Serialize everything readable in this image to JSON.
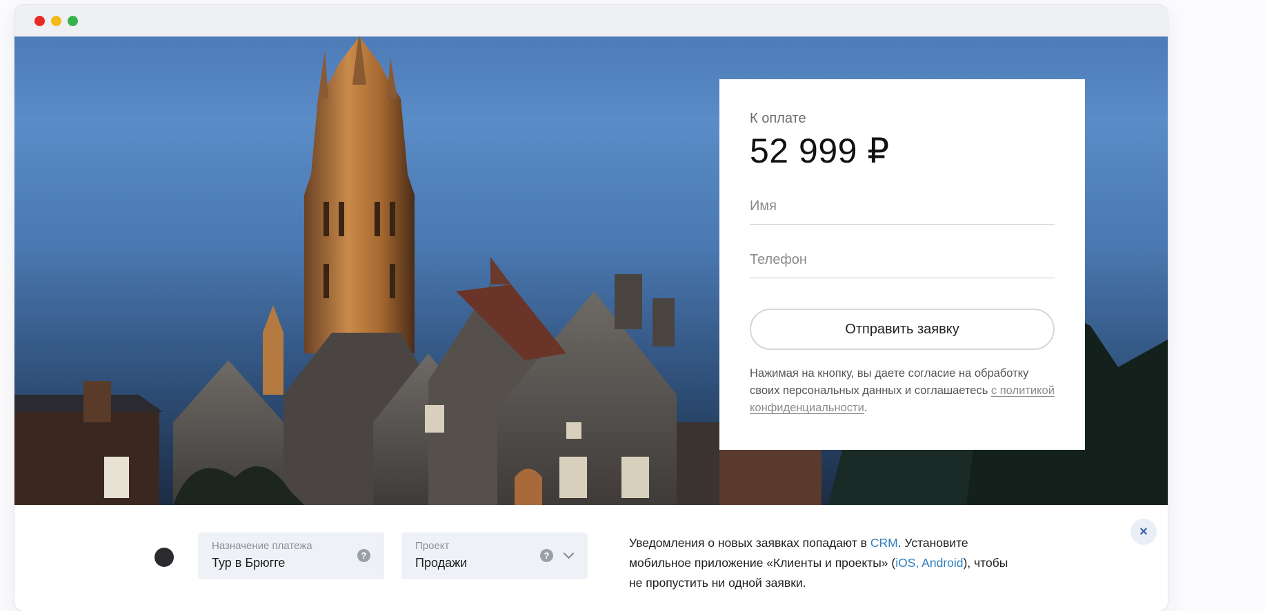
{
  "colors": {
    "accent_link": "#2d7fc1",
    "close_bg": "#e9eef7",
    "traffic_red": "#e82a24",
    "traffic_yellow": "#f5b918",
    "traffic_green": "#36b34a"
  },
  "payment_card": {
    "label": "К оплате",
    "amount": "52 999 ₽",
    "name_placeholder": "Имя",
    "phone_placeholder": "Телефон",
    "submit_label": "Отправить заявку",
    "consent_text": "Нажимая на кнопку, вы даете согласие на обработку своих персональных данных и соглашаетесь ",
    "consent_link": "с политикой конфиденциальности",
    "consent_end": "."
  },
  "settings": {
    "purpose": {
      "caption": "Назначение платежа",
      "value": "Тур в Брюгге",
      "help_icon": "question-icon"
    },
    "project": {
      "caption": "Проект",
      "value": "Продажи",
      "help_icon": "question-icon",
      "dropdown_icon": "chevron-down-icon"
    }
  },
  "notice": {
    "part1": "Уведомления о новых заявках попадают в ",
    "crm_link": "CRM",
    "part2": ". Установите мобильное приложение «Клиенты и проекты» (",
    "apps_link": "iOS, Android",
    "part3": "), чтобы не пропустить ни одной заявки."
  },
  "close_label": "×"
}
